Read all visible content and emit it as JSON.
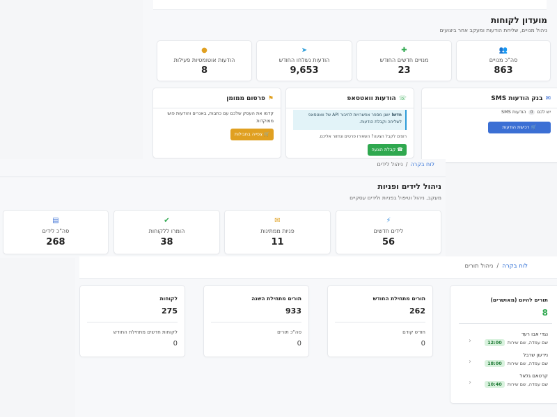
{
  "club": {
    "title": "מועדון לקוחות",
    "subtitle": "ניהול מנויים, שליחת הודעות ומעקב אחר ביצועים",
    "stats": [
      {
        "label": "סה\"כ מנויים",
        "value": "863",
        "icon": "users-icon",
        "color": "#3b6fd4"
      },
      {
        "label": "מנויים חדשים החודש",
        "value": "23",
        "icon": "user-plus-icon",
        "color": "#2fa84f"
      },
      {
        "label": "הודעות נשלחו החודש",
        "value": "9,653",
        "icon": "send-icon",
        "color": "#2b9bd8"
      },
      {
        "label": "הודעות אוטומטיות פעילות",
        "value": "8",
        "icon": "robot-icon",
        "color": "#e0a021"
      }
    ],
    "sms": {
      "title": "בנק הודעות SMS",
      "balance_prefix": "יש לכם",
      "balance": "0",
      "balance_suffix": "הודעות SMS",
      "button": "רכישת הודעות"
    },
    "whatsapp": {
      "title": "הודעות וואטסאפ",
      "notice_bold": "חדש!",
      "notice": "ישנן מספר אפשרויות לחיבור API של וואטסאפ לשליחה וקבלת הודעות.",
      "note": "רוצים לקבל הצעה? השאירו פרטים ונחזור אליכם.",
      "button": "קבלת הצעה"
    },
    "ads": {
      "title": "פרסום ממומן",
      "text": "קדמו את העסק שלכם עם כתבות, באנרים והודעות פוש ממוקדות",
      "button": "צפייה בחבילות"
    }
  },
  "leads": {
    "breadcrumb_home": "לוח בקרה",
    "breadcrumb_sep": "/",
    "breadcrumb_current": "ניהול לידים",
    "title": "ניהול לידים ופניות",
    "subtitle": "מעקב, ניהול וטיפול בפניות ולידים עסקיים",
    "stats": [
      {
        "label": "לידים חדשים",
        "value": "56",
        "icon": "bolt-icon",
        "color": "#3b8fe0"
      },
      {
        "label": "פניות ממתינות",
        "value": "11",
        "icon": "envelope-open-icon",
        "color": "#e0a021"
      },
      {
        "label": "הומרו ללקוחות",
        "value": "38",
        "icon": "user-check-icon",
        "color": "#2fa84f"
      },
      {
        "label": "סה\"כ לידים",
        "value": "268",
        "icon": "database-icon",
        "color": "#3b6fd4"
      }
    ]
  },
  "appointments": {
    "breadcrumb_home": "לוח בקרה",
    "breadcrumb_sep": "/",
    "breadcrumb_current": "ניהול תורים",
    "today": {
      "title": "תורים להיום (מאושרים)",
      "value": "8",
      "items": [
        {
          "name": "נגדי אבו רעד",
          "service": "שם עמדה, שם שירות",
          "time": "12:00"
        },
        {
          "name": "נידעון שרבל",
          "service": "שם עמדה, שם שירות",
          "time": "18:00"
        },
        {
          "name": "קרטאם גלאל",
          "service": "שם עמדה, שם שירות",
          "time": "10:40"
        }
      ]
    },
    "month": {
      "title": "תורים מתחילת החודש",
      "value": "262",
      "sub_label": "חודש קודם",
      "sub_value": "0"
    },
    "year": {
      "title": "תורים מתחילת השנה",
      "value": "933",
      "sub_label": "סה\"כ תורים",
      "sub_value": "0"
    },
    "customers": {
      "title": "לקוחות",
      "value": "275",
      "sub_label": "לקוחות חדשים מתחילת החודש",
      "sub_value": "0"
    }
  }
}
